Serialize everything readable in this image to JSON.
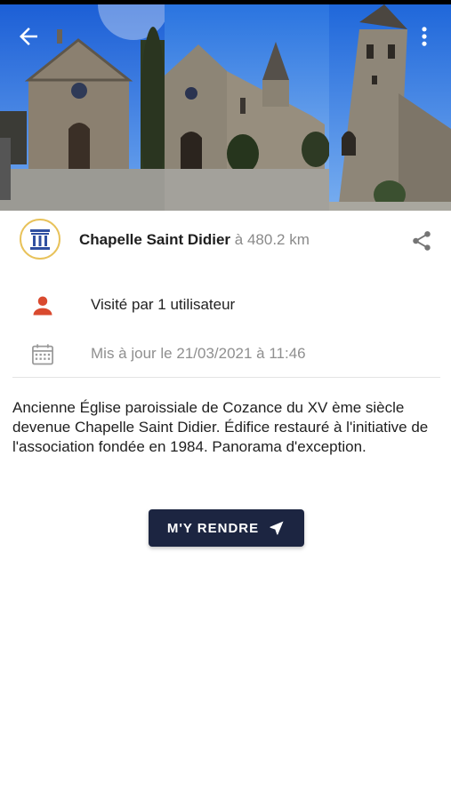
{
  "colors": {
    "accent_red": "#d94a2f",
    "button_bg": "#1c2541",
    "logo_ring": "#e8c25a",
    "logo_blue": "#2f4fa0"
  },
  "gallery": {
    "photos": [
      {
        "name": "gallery-photo-facade"
      },
      {
        "name": "gallery-photo-side"
      },
      {
        "name": "gallery-photo-tower"
      }
    ]
  },
  "toolbar": {
    "back_icon": "arrow-left-icon",
    "menu_icon": "more-vertical-icon"
  },
  "place": {
    "name": "Chapelle Saint Didier",
    "distance": "à 480.2 km",
    "logo_icon": "monument-icon",
    "share_icon": "share-icon"
  },
  "info": {
    "visited": "Visité par 1 utilisateur",
    "updated": "Mis à jour le 21/03/2021 à 11:46"
  },
  "description": "Ancienne Église paroissiale de Cozance du XV ème siècle devenue Chapelle Saint Didier. Édifice restauré à l'initiative de l'association fondée en 1984. Panorama d'exception.",
  "action": {
    "label": "M'Y RENDRE",
    "icon": "navigation-arrow-icon"
  }
}
